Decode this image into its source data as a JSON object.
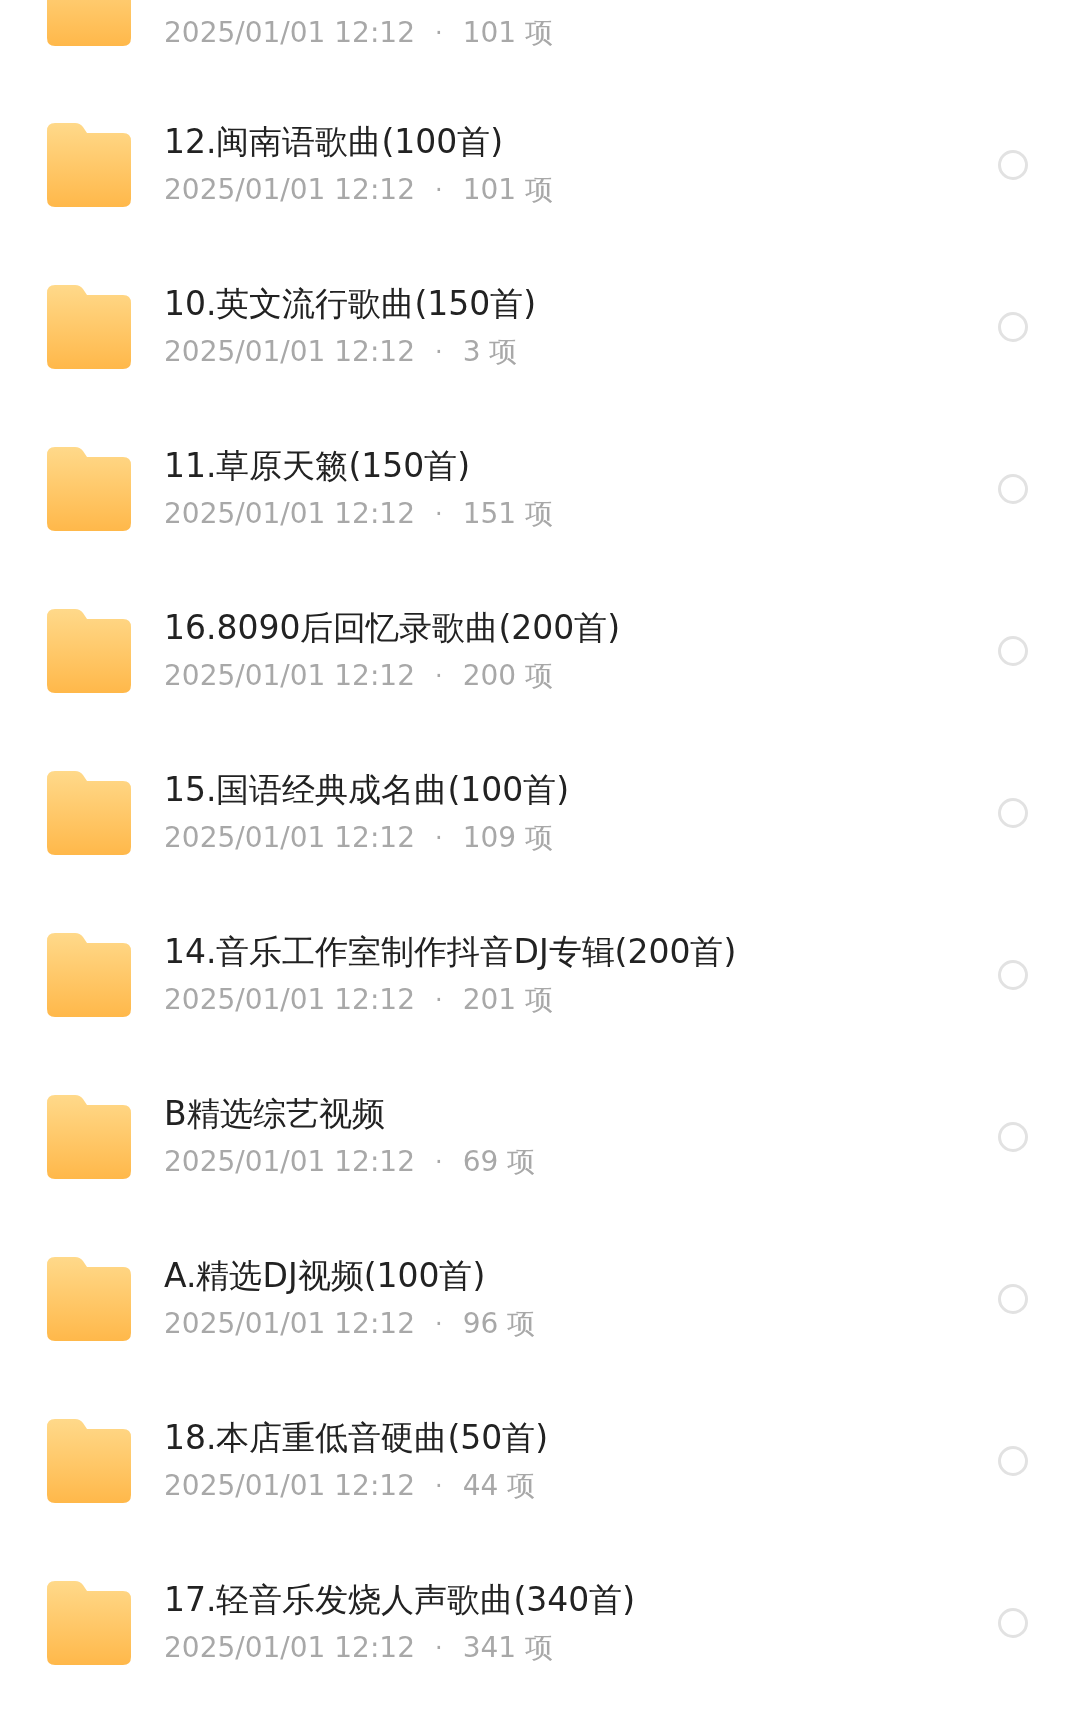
{
  "partial_item": {
    "date": "2025/01/01 12:12",
    "separator": "·",
    "count": "101 项"
  },
  "items": [
    {
      "name": "12.闽南语歌曲(100首)",
      "date": "2025/01/01 12:12",
      "separator": "·",
      "count": "101 项",
      "selected": false
    },
    {
      "name": "10.英文流行歌曲(150首)",
      "date": "2025/01/01 12:12",
      "separator": "·",
      "count": "3 项",
      "selected": false
    },
    {
      "name": "11.草原天籁(150首)",
      "date": "2025/01/01 12:12",
      "separator": "·",
      "count": "151 项",
      "selected": false
    },
    {
      "name": "16.8090后回忆录歌曲(200首)",
      "date": "2025/01/01 12:12",
      "separator": "·",
      "count": "200 项",
      "selected": false
    },
    {
      "name": "15.国语经典成名曲(100首)",
      "date": "2025/01/01 12:12",
      "separator": "·",
      "count": "109 项",
      "selected": false
    },
    {
      "name": "14.音乐工作室制作抖音DJ专辑(200首)",
      "date": "2025/01/01 12:12",
      "separator": "·",
      "count": "201 项",
      "selected": false
    },
    {
      "name": "B精选综艺视频",
      "date": "2025/01/01 12:12",
      "separator": "·",
      "count": "69 项",
      "selected": false
    },
    {
      "name": "A.精选DJ视频(100首)",
      "date": "2025/01/01 12:12",
      "separator": "·",
      "count": "96 项",
      "selected": false
    },
    {
      "name": "18.本店重低音硬曲(50首)",
      "date": "2025/01/01 12:12",
      "separator": "·",
      "count": "44 项",
      "selected": false
    },
    {
      "name": "17.轻音乐发烧人声歌曲(340首)",
      "date": "2025/01/01 12:12",
      "separator": "·",
      "count": "341 项",
      "selected": false
    }
  ]
}
